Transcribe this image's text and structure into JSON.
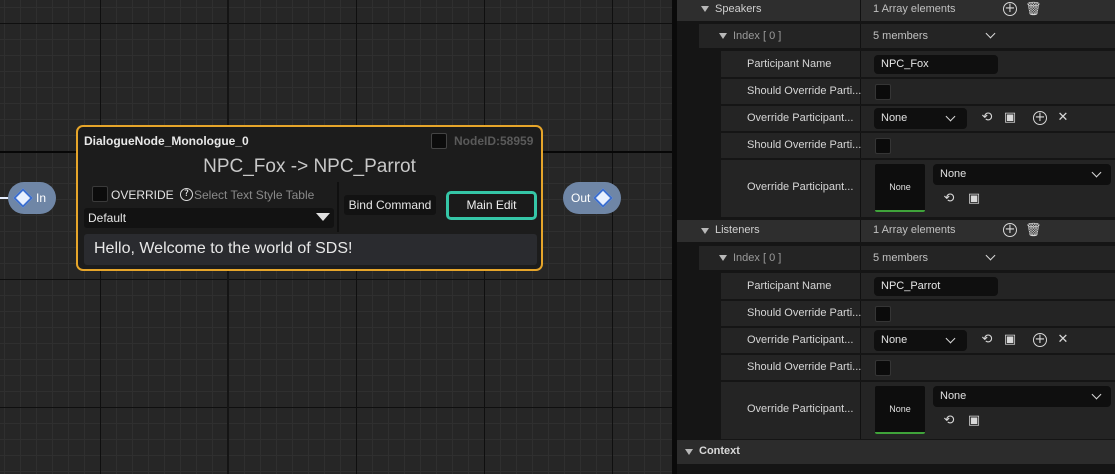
{
  "graph": {
    "pin_in": "In",
    "pin_out": "Out",
    "node": {
      "title": "DialogueNode_Monologue_0",
      "node_id": "NodeID:58959",
      "heading": "NPC_Fox -> NPC_Parrot",
      "override_label": "OVERRIDE",
      "text_style_placeholder": "Select Text Style Table",
      "text_style_value": "Default",
      "bind_command": "Bind Command",
      "main_edit": "Main Edit",
      "dialogue": "Hello, Welcome to the world of SDS!"
    }
  },
  "details": {
    "speakers": {
      "label": "Speakers",
      "count": "1 Array elements",
      "index_label": "Index [ 0 ]",
      "members": "5 members",
      "participant_name_label": "Participant Name",
      "participant_name": "NPC_Fox",
      "should_override_1": "Should Override Parti...",
      "override_participant_1": "Override Participant...",
      "combo_value": "None",
      "should_override_2": "Should Override Parti...",
      "override_participant_2": "Override Participant...",
      "thumb_label": "None",
      "combo2_value": "None"
    },
    "listeners": {
      "label": "Listeners",
      "count": "1 Array elements",
      "index_label": "Index [ 0 ]",
      "members": "5 members",
      "participant_name_label": "Participant Name",
      "participant_name": "NPC_Parrot",
      "should_override_1": "Should Override Parti...",
      "override_participant_1": "Override Participant...",
      "combo_value": "None",
      "should_override_2": "Should Override Parti...",
      "override_participant_2": "Override Participant...",
      "thumb_label": "None",
      "combo2_value": "None"
    },
    "context": "Context"
  }
}
